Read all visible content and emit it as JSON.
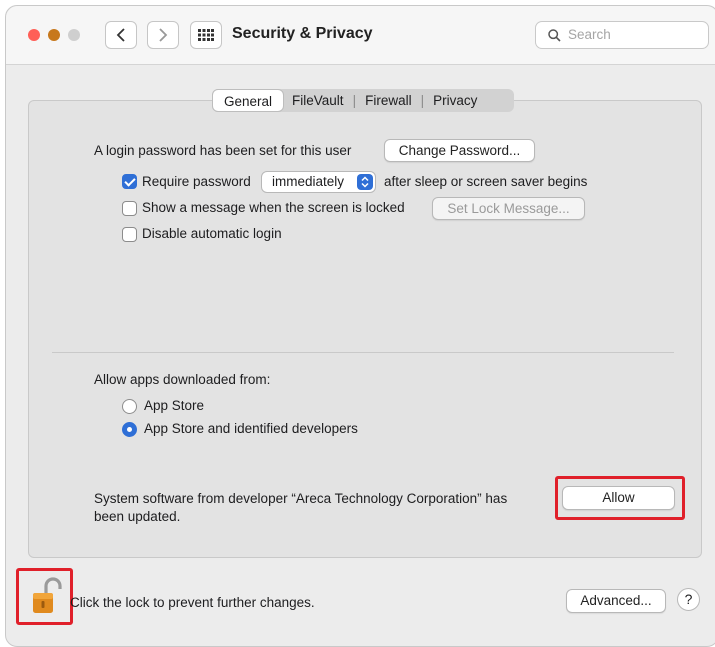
{
  "window": {
    "title": "Security & Privacy",
    "search_placeholder": "Search"
  },
  "tabs": [
    {
      "label": "General",
      "active": true
    },
    {
      "label": "FileVault",
      "active": false
    },
    {
      "label": "Firewall",
      "active": false
    },
    {
      "label": "Privacy",
      "active": false
    }
  ],
  "general": {
    "login_text": "A login password has been set for this user",
    "change_password_label": "Change Password...",
    "require_password": {
      "label": "Require password",
      "checked": true,
      "value": "immediately",
      "suffix": "after sleep or screen saver begins"
    },
    "show_message": {
      "label": "Show a message when the screen is locked",
      "checked": false,
      "button_label": "Set Lock Message..."
    },
    "disable_autologin": {
      "label": "Disable automatic login",
      "checked": false
    }
  },
  "downloads": {
    "heading": "Allow apps downloaded from:",
    "options": [
      {
        "label": "App Store",
        "selected": false
      },
      {
        "label": "App Store and identified developers",
        "selected": true
      }
    ]
  },
  "system_software": {
    "message_line1": "System software from developer “Areca Technology Corporation” has",
    "message_line2": "been updated.",
    "allow_label": "Allow"
  },
  "footer": {
    "lock_text": "Click the lock to prevent further changes.",
    "advanced_label": "Advanced...",
    "help_label": "?"
  },
  "colors": {
    "accent": "#2f6fd6",
    "highlight": "#e0202a",
    "close": "#ff5f57",
    "minimize": "#c7781c",
    "inactive": "#cfcfcf"
  }
}
